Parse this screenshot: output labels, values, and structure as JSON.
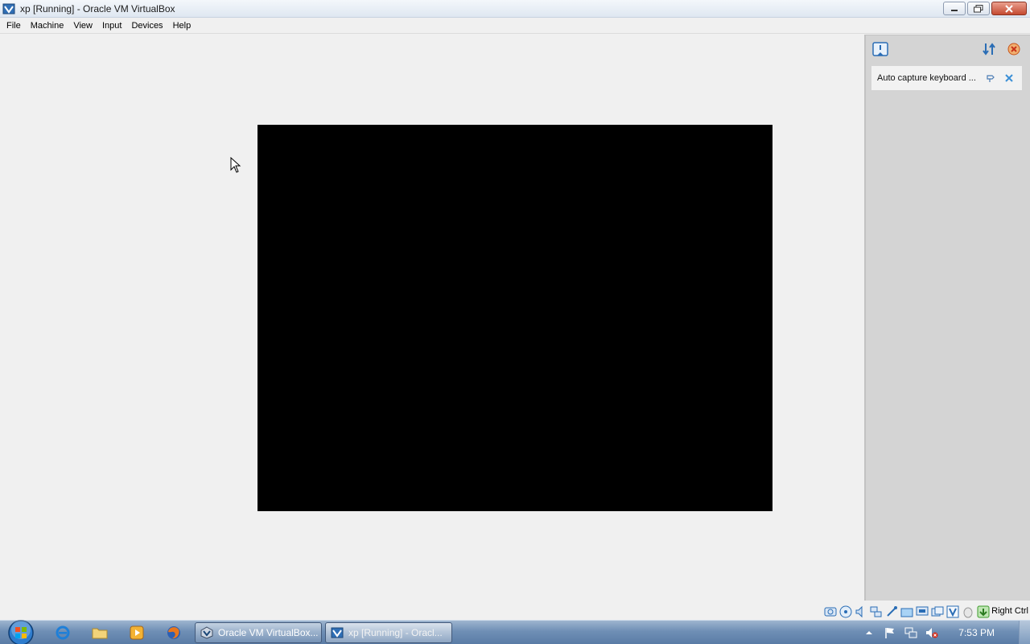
{
  "window": {
    "title": "xp [Running] - Oracle VM VirtualBox",
    "icon": "virtualbox-icon"
  },
  "menu": [
    "File",
    "Machine",
    "View",
    "Input",
    "Devices",
    "Help"
  ],
  "notifications": {
    "items": [
      {
        "text": "Auto capture keyboard ..."
      }
    ]
  },
  "statusbar": {
    "icons": [
      "hard-disk-icon",
      "optical-drive-icon",
      "audio-icon",
      "network-icon",
      "usb-icon",
      "shared-folders-icon",
      "display-icon",
      "video-capture-icon",
      "virtualization-icon",
      "mouse-integration-icon",
      "keyboard-capture-icon"
    ],
    "host_key": "Right Ctrl"
  },
  "taskbar": {
    "quick_launch": [
      "internet-explorer-icon",
      "file-explorer-icon",
      "media-player-icon",
      "firefox-icon"
    ],
    "tasks": [
      {
        "label": "Oracle VM VirtualBox..."
      },
      {
        "label": "xp [Running] - Oracl..."
      }
    ],
    "tray_icons": [
      "show-hidden-icons-icon",
      "action-center-flag-icon",
      "network-tray-icon",
      "volume-muted-icon"
    ],
    "clock": "7:53 PM"
  },
  "colors": {
    "vm_screen": "#000000",
    "background": "#f0f0f0",
    "taskbar": "#6f8fb5"
  }
}
